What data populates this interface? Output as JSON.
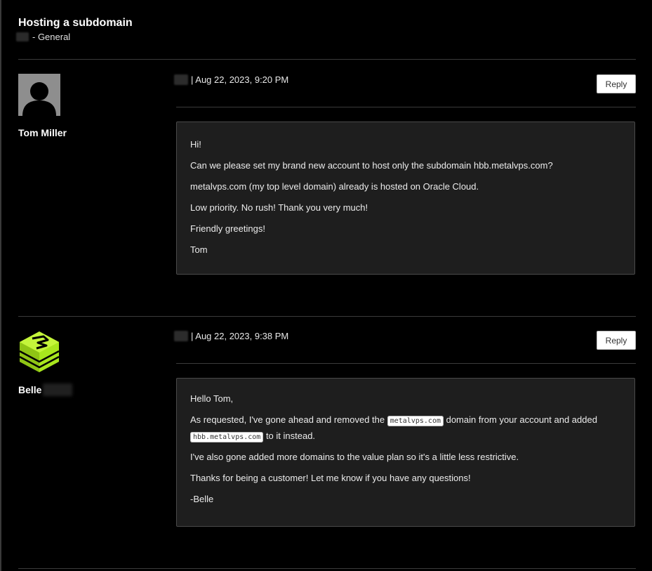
{
  "thread": {
    "title": "Hosting a subdomain",
    "category": "- General"
  },
  "posts": [
    {
      "author": "Tom Miller",
      "avatar_icon": "default-user-avatar-icon",
      "timestamp": "| Aug 22, 2023, 9:20 PM",
      "reply_label": "Reply",
      "lines": [
        "Hi!",
        "Can we please set my brand new account to host only the subdomain hbb.metalvps.com?",
        "metalvps.com (my top level domain) already is hosted on Oracle Cloud.",
        "Low priority. No rush! Thank you very much!",
        "Friendly greetings!",
        "Tom"
      ]
    },
    {
      "author": "Belle",
      "avatar_icon": "lime-cube-logo-icon",
      "timestamp": "| Aug 22, 2023, 9:38 PM",
      "reply_label": "Reply",
      "greeting": "Hello Tom,",
      "para2": {
        "before": "As requested, I've gone ahead and removed the ",
        "code1": "metalvps.com",
        "middle": " domain from your account and added ",
        "code2": "hbb.metalvps.com",
        "after": " to it instead."
      },
      "lines_after": [
        "I've also gone added more domains to the value plan so it's a little less restrictive.",
        "Thanks for being a customer! Let me know if you have any questions!",
        "-Belle"
      ]
    }
  ],
  "colors": {
    "background": "#000000",
    "panel": "#1e1e1e",
    "accent_lime": "#a8e61d"
  }
}
